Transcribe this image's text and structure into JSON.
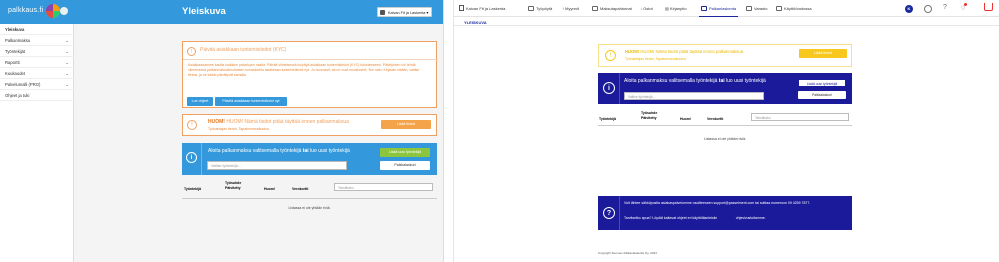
{
  "left": {
    "logo": "palkkaus.fi",
    "header_title": "Yleiskuva",
    "company_selector": "Kaivan Fit ja Laskenta",
    "sidebar": [
      {
        "label": "Yleiskuva",
        "chevron": false,
        "active": true
      },
      {
        "label": "Palkanmaksu",
        "chevron": true
      },
      {
        "label": "Työntekijät",
        "chevron": true
      },
      {
        "label": "Raportit",
        "chevron": true
      },
      {
        "label": "Kuukaudet",
        "chevron": true
      },
      {
        "label": "Palvelumalli (PRO)",
        "chevron": true
      },
      {
        "label": "Ohjeet ja tuki",
        "chevron": false
      }
    ],
    "kyc": {
      "title": "Päivitä asiakkaan tuntemistiedot (KYC)",
      "body": "Asiakkaanamme kaufta kaikkien palvelujen osalta. Päivitä viimeisessä kulyttyä asiakkaan tuntemistiedot (KYC) tulosteeseesi. Päivityksen voi tehdä viimeisessä palkanmaksuilmoitusten lomakkeella asiakkaan tuntemistiedot nyt. Jo huomasit, tai ne ovat muuttuneet, Tee näin: Kirjaudu sisään, valitse tietosi, ja ne kaikki päivittyvät samalla",
      "btn_guide": "Lue ohjeet",
      "btn_update": "Päivitä asiakkaan tuntemistiedot nyt"
    },
    "notice": {
      "title": "HUOM! Nämä tiedot pitää täyttää ennen palkanmaksua",
      "link": "Työnantajan tiedot, Tapaturmavakuutus",
      "button": "Lisää tiedot"
    },
    "start": {
      "text_pre": "Aloita palkanmaksu valitsemalla työntekijä ",
      "text_bold": "tai",
      "text_post": " luo uusi työntekijä",
      "search_placeholder": "Valitse työntekijä...",
      "btn_add": "Lisää uusi työntekijä",
      "btn_calc": "Palkkalaskuri"
    },
    "table": {
      "headers": [
        "Työntekijä",
        "Työsuhde Päivitetty",
        "Huom!",
        "Verokortti"
      ],
      "search_placeholder": "Tekstihaku",
      "empty": "Listassa ei ole yhtään riviä."
    }
  },
  "right": {
    "company": "Kaivan Fit ja Laskenta",
    "nav": [
      "Työpöytä",
      "Myynnit",
      "Maksutapahtumat",
      "Ostot",
      "Kirjanpito",
      "Palkanlaskenta",
      "Varasto",
      "Käyttöönotossa"
    ],
    "nav_active": "Palkanlaskenta",
    "user_initial": "K",
    "subnav": "YLEISKUVA",
    "notice": {
      "title": "HUOM! Nämä tiedot pitää täyttää ennen palkanmaksua",
      "link": "Työnantajan tiedot, Tapaturmavakuutus",
      "button": "Lisää tiedot"
    },
    "start": {
      "text_pre": "Aloita palkanmaksu valitsemalla työntekijä ",
      "text_bold": "tai",
      "text_post": " luo uusi työntekijä",
      "search_placeholder": "Valitse työntekijä...",
      "btn_add": "Lisää uusi työntekijä",
      "btn_calc": "Palkkalaskuri"
    },
    "table": {
      "headers": [
        "Työntekijä",
        "Työsuhde Päivitetty",
        "Huom!",
        "Verokortti"
      ],
      "search_placeholder": "Tekstihaku",
      "empty": "Listassa ei ole yhtään riviä."
    },
    "support": {
      "line1": "Voit lähtee sähköpostia asiakaspalvelumme osoitteeseen support@passelment.com tai soittaa numeroon 09 4259 7877.",
      "line2_pre": "Tarvitsetko apua? Löydät kattavat ohjeet eri käyttötilanteisiin ",
      "line2_link": "palkkaus.fi",
      "line2_post": " ohjesivustoltamme."
    },
    "copyright": "Copyright Suomen Palkanlaskenta Oy, 2024"
  },
  "colors": {
    "blue": "#3399dc",
    "navy": "#1a1a9a",
    "orange": "#f0a060",
    "green": "#8cc63e",
    "notice_btn": "#f5a34a",
    "accent_yellow": "#f8c81c"
  }
}
